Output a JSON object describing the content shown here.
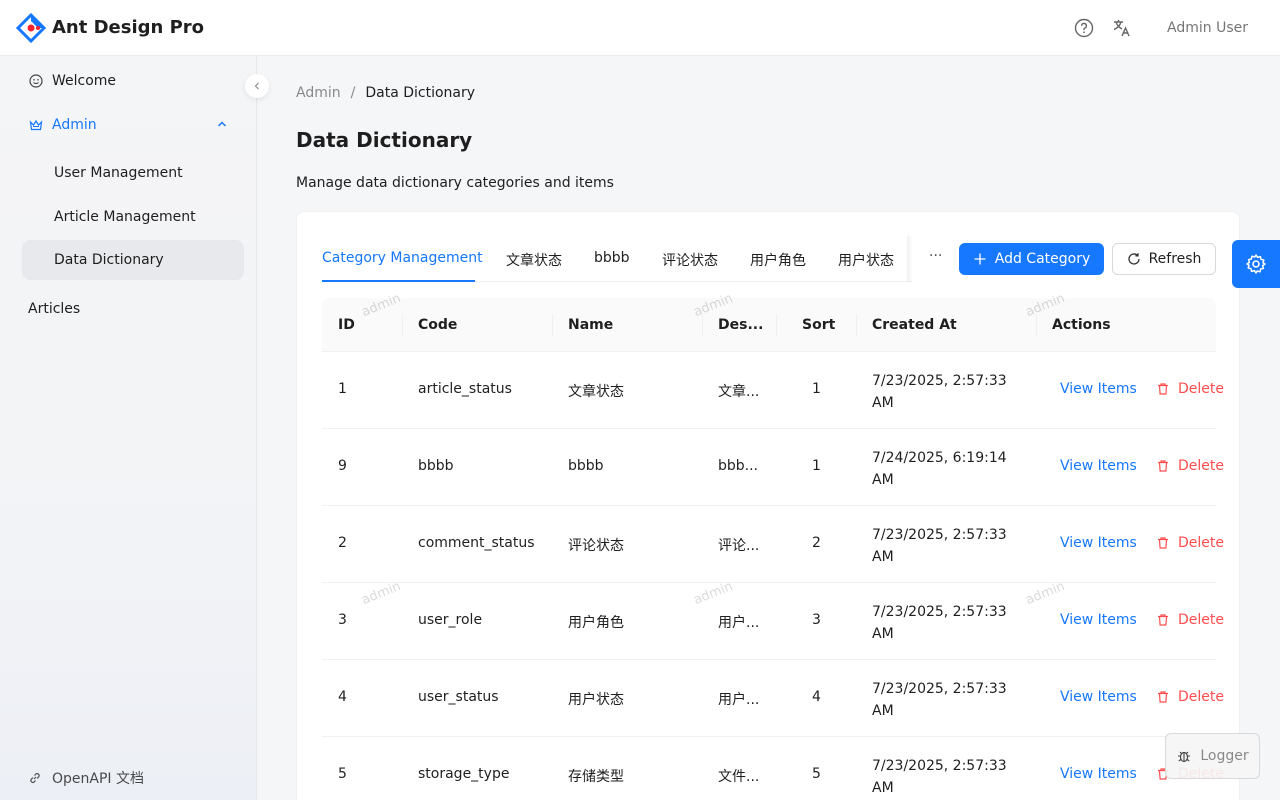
{
  "app": {
    "title": "Ant Design Pro"
  },
  "header": {
    "help_icon": "question-circle-icon",
    "lang_icon": "translation-icon",
    "user_name": "Admin User"
  },
  "sidebar": {
    "items": [
      {
        "label": "Welcome",
        "icon": "smile-icon"
      },
      {
        "label": "Admin",
        "icon": "crown-icon"
      },
      {
        "label": "User Management"
      },
      {
        "label": "Article Management"
      },
      {
        "label": "Data Dictionary"
      },
      {
        "label": "Articles"
      }
    ],
    "footer": {
      "label": "OpenAPI 文档",
      "icon": "link-icon"
    }
  },
  "breadcrumb": {
    "parent": "Admin",
    "separator": "/",
    "current": "Data Dictionary"
  },
  "page": {
    "title": "Data Dictionary",
    "description": "Manage data dictionary categories and items"
  },
  "tabs": [
    {
      "label": "Category Management"
    },
    {
      "label": "文章状态"
    },
    {
      "label": "bbbb"
    },
    {
      "label": "评论状态"
    },
    {
      "label": "用户角色"
    },
    {
      "label": "用户状态"
    }
  ],
  "tabs_more": "···",
  "buttons": {
    "add_category": "Add Category",
    "refresh": "Refresh"
  },
  "table": {
    "columns": [
      "ID",
      "Code",
      "Name",
      "Des...",
      "Sort",
      "Created At",
      "Actions"
    ],
    "rows": [
      {
        "id": "1",
        "code": "article_status",
        "name": "文章状态",
        "desc": "文章...",
        "sort": "1",
        "created": "7/23/2025, 2:57:33 AM"
      },
      {
        "id": "9",
        "code": "bbbb",
        "name": "bbbb",
        "desc": "bbb...",
        "sort": "1",
        "created": "7/24/2025, 6:19:14 AM"
      },
      {
        "id": "2",
        "code": "comment_status",
        "name": "评论状态",
        "desc": "评论...",
        "sort": "2",
        "created": "7/23/2025, 2:57:33 AM"
      },
      {
        "id": "3",
        "code": "user_role",
        "name": "用户角色",
        "desc": "用户...",
        "sort": "3",
        "created": "7/23/2025, 2:57:33 AM"
      },
      {
        "id": "4",
        "code": "user_status",
        "name": "用户状态",
        "desc": "用户...",
        "sort": "4",
        "created": "7/23/2025, 2:57:33 AM"
      },
      {
        "id": "5",
        "code": "storage_type",
        "name": "存储类型",
        "desc": "文件...",
        "sort": "5",
        "created": "7/23/2025, 2:57:33 AM"
      }
    ],
    "actions": {
      "view": "View Items",
      "delete": "Delete"
    }
  },
  "watermark": "admin",
  "floating": {
    "settings_icon": "setting-icon",
    "logger_label": "Logger"
  },
  "colors": {
    "primary": "#1677ff",
    "danger": "#ff4d4f"
  }
}
